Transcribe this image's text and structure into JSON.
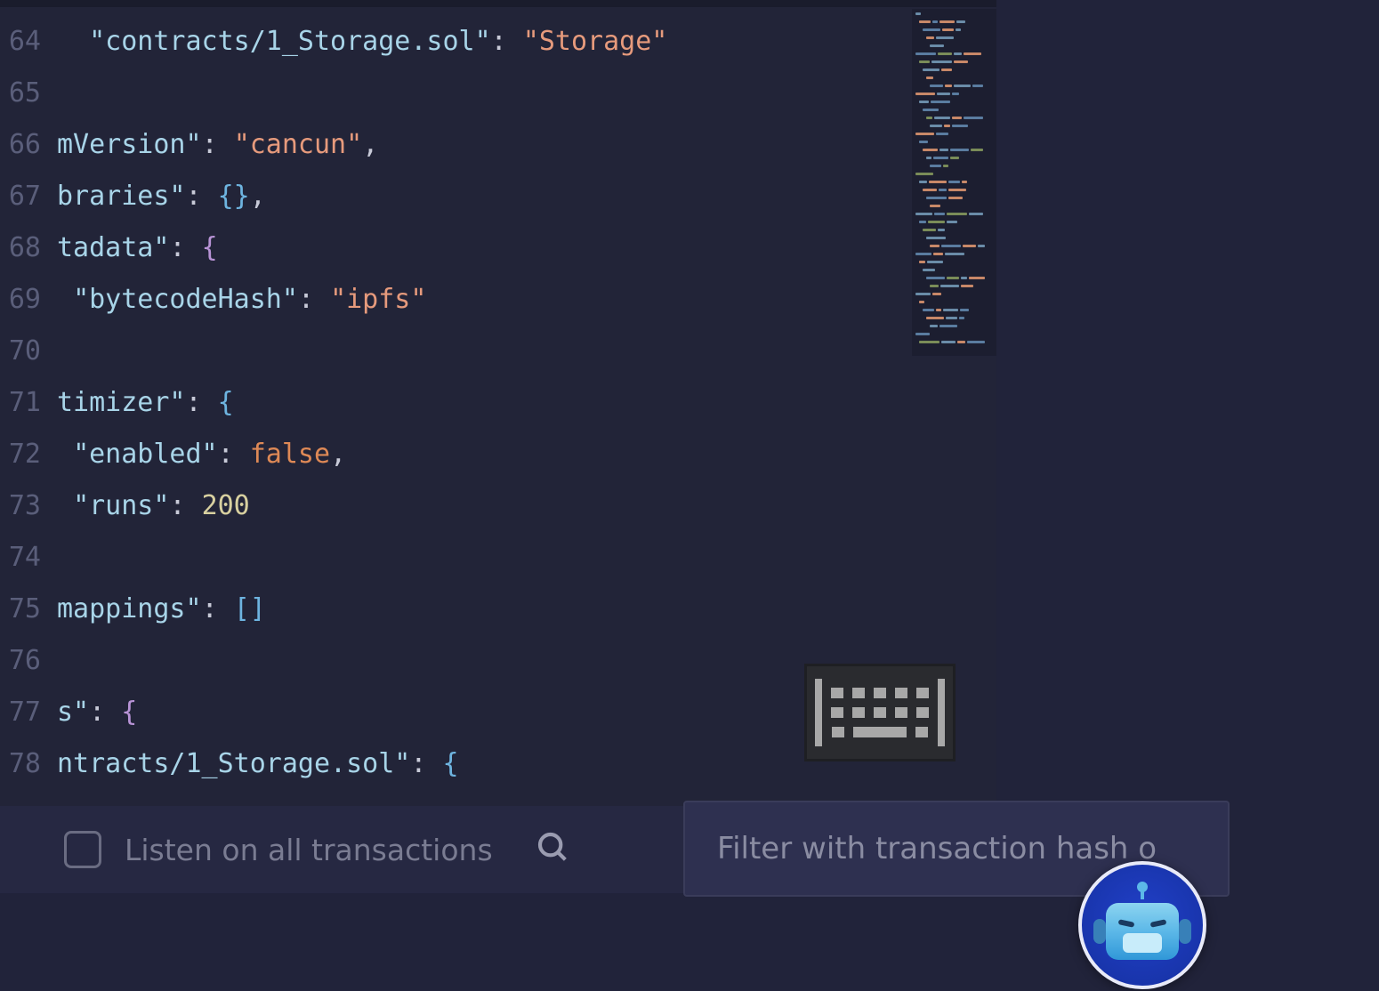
{
  "editor": {
    "lines": [
      {
        "num": "64",
        "tokens": [
          {
            "t": "  ",
            "c": "punc"
          },
          {
            "t": "\"contracts/1_Storage.sol\"",
            "c": "key"
          },
          {
            "t": ": ",
            "c": "colon"
          },
          {
            "t": "\"Storage\"",
            "c": "string"
          }
        ]
      },
      {
        "num": "65",
        "tokens": []
      },
      {
        "num": "66",
        "tokens": [
          {
            "t": "mVersion\"",
            "c": "key"
          },
          {
            "t": ": ",
            "c": "colon"
          },
          {
            "t": "\"cancun\"",
            "c": "string"
          },
          {
            "t": ",",
            "c": "punc"
          }
        ]
      },
      {
        "num": "67",
        "tokens": [
          {
            "t": "braries\"",
            "c": "key"
          },
          {
            "t": ": ",
            "c": "colon"
          },
          {
            "t": "{}",
            "c": "braceb"
          },
          {
            "t": ",",
            "c": "punc"
          }
        ]
      },
      {
        "num": "68",
        "tokens": [
          {
            "t": "tadata\"",
            "c": "key"
          },
          {
            "t": ": ",
            "c": "colon"
          },
          {
            "t": "{",
            "c": "brace"
          }
        ]
      },
      {
        "num": "69",
        "tokens": [
          {
            "t": " ",
            "c": "punc"
          },
          {
            "t": "\"bytecodeHash\"",
            "c": "key"
          },
          {
            "t": ": ",
            "c": "colon"
          },
          {
            "t": "\"ipfs\"",
            "c": "string"
          }
        ]
      },
      {
        "num": "70",
        "tokens": []
      },
      {
        "num": "71",
        "tokens": [
          {
            "t": "timizer\"",
            "c": "key"
          },
          {
            "t": ": ",
            "c": "colon"
          },
          {
            "t": "{",
            "c": "braceb"
          }
        ]
      },
      {
        "num": "72",
        "tokens": [
          {
            "t": " ",
            "c": "punc"
          },
          {
            "t": "\"enabled\"",
            "c": "key"
          },
          {
            "t": ": ",
            "c": "colon"
          },
          {
            "t": "false",
            "c": "bool"
          },
          {
            "t": ",",
            "c": "punc"
          }
        ]
      },
      {
        "num": "73",
        "tokens": [
          {
            "t": " ",
            "c": "punc"
          },
          {
            "t": "\"runs\"",
            "c": "key"
          },
          {
            "t": ": ",
            "c": "colon"
          },
          {
            "t": "200",
            "c": "number"
          }
        ]
      },
      {
        "num": "74",
        "tokens": []
      },
      {
        "num": "75",
        "tokens": [
          {
            "t": "mappings\"",
            "c": "key"
          },
          {
            "t": ": ",
            "c": "colon"
          },
          {
            "t": "[]",
            "c": "braceb"
          }
        ]
      },
      {
        "num": "76",
        "tokens": []
      },
      {
        "num": "77",
        "tokens": [
          {
            "t": "s\"",
            "c": "key"
          },
          {
            "t": ": ",
            "c": "colon"
          },
          {
            "t": "{",
            "c": "brace"
          }
        ]
      },
      {
        "num": "78",
        "tokens": [
          {
            "t": "ntracts/1_Storage.sol\"",
            "c": "key"
          },
          {
            "t": ": ",
            "c": "colon"
          },
          {
            "t": "{",
            "c": "braceb"
          }
        ]
      }
    ]
  },
  "filterBar": {
    "checkbox_label": "Listen on all transactions",
    "input_placeholder": "Filter with transaction hash o"
  },
  "colors": {
    "background": "#1e2030",
    "editor_bg": "#222438",
    "string": "#e69a7c",
    "key": "#a8d4e8",
    "bool": "#de8956",
    "number": "#d8d0a0"
  }
}
